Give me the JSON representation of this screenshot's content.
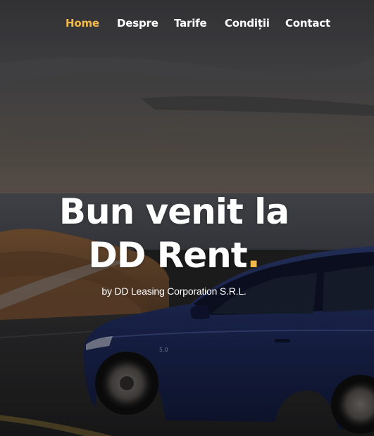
{
  "nav": {
    "items": [
      {
        "label": "Home",
        "active": true
      },
      {
        "label": "Despre",
        "active": false
      },
      {
        "label": "Tarife",
        "active": false
      },
      {
        "label": "Condiții",
        "active": false
      },
      {
        "label": "Contact",
        "active": false
      }
    ]
  },
  "hero": {
    "title_line1": "Bun venit la",
    "title_line2": "DD Rent",
    "title_dot": ".",
    "tagline": "by DD Leasing Corporation S.R.L."
  },
  "colors": {
    "accent": "#f2b948",
    "text": "#ffffff",
    "sky": "#4a4a4c",
    "car_body": "#1a2550"
  },
  "background": {
    "subject": "dark blue sports car driving on coastal road at dusk"
  }
}
